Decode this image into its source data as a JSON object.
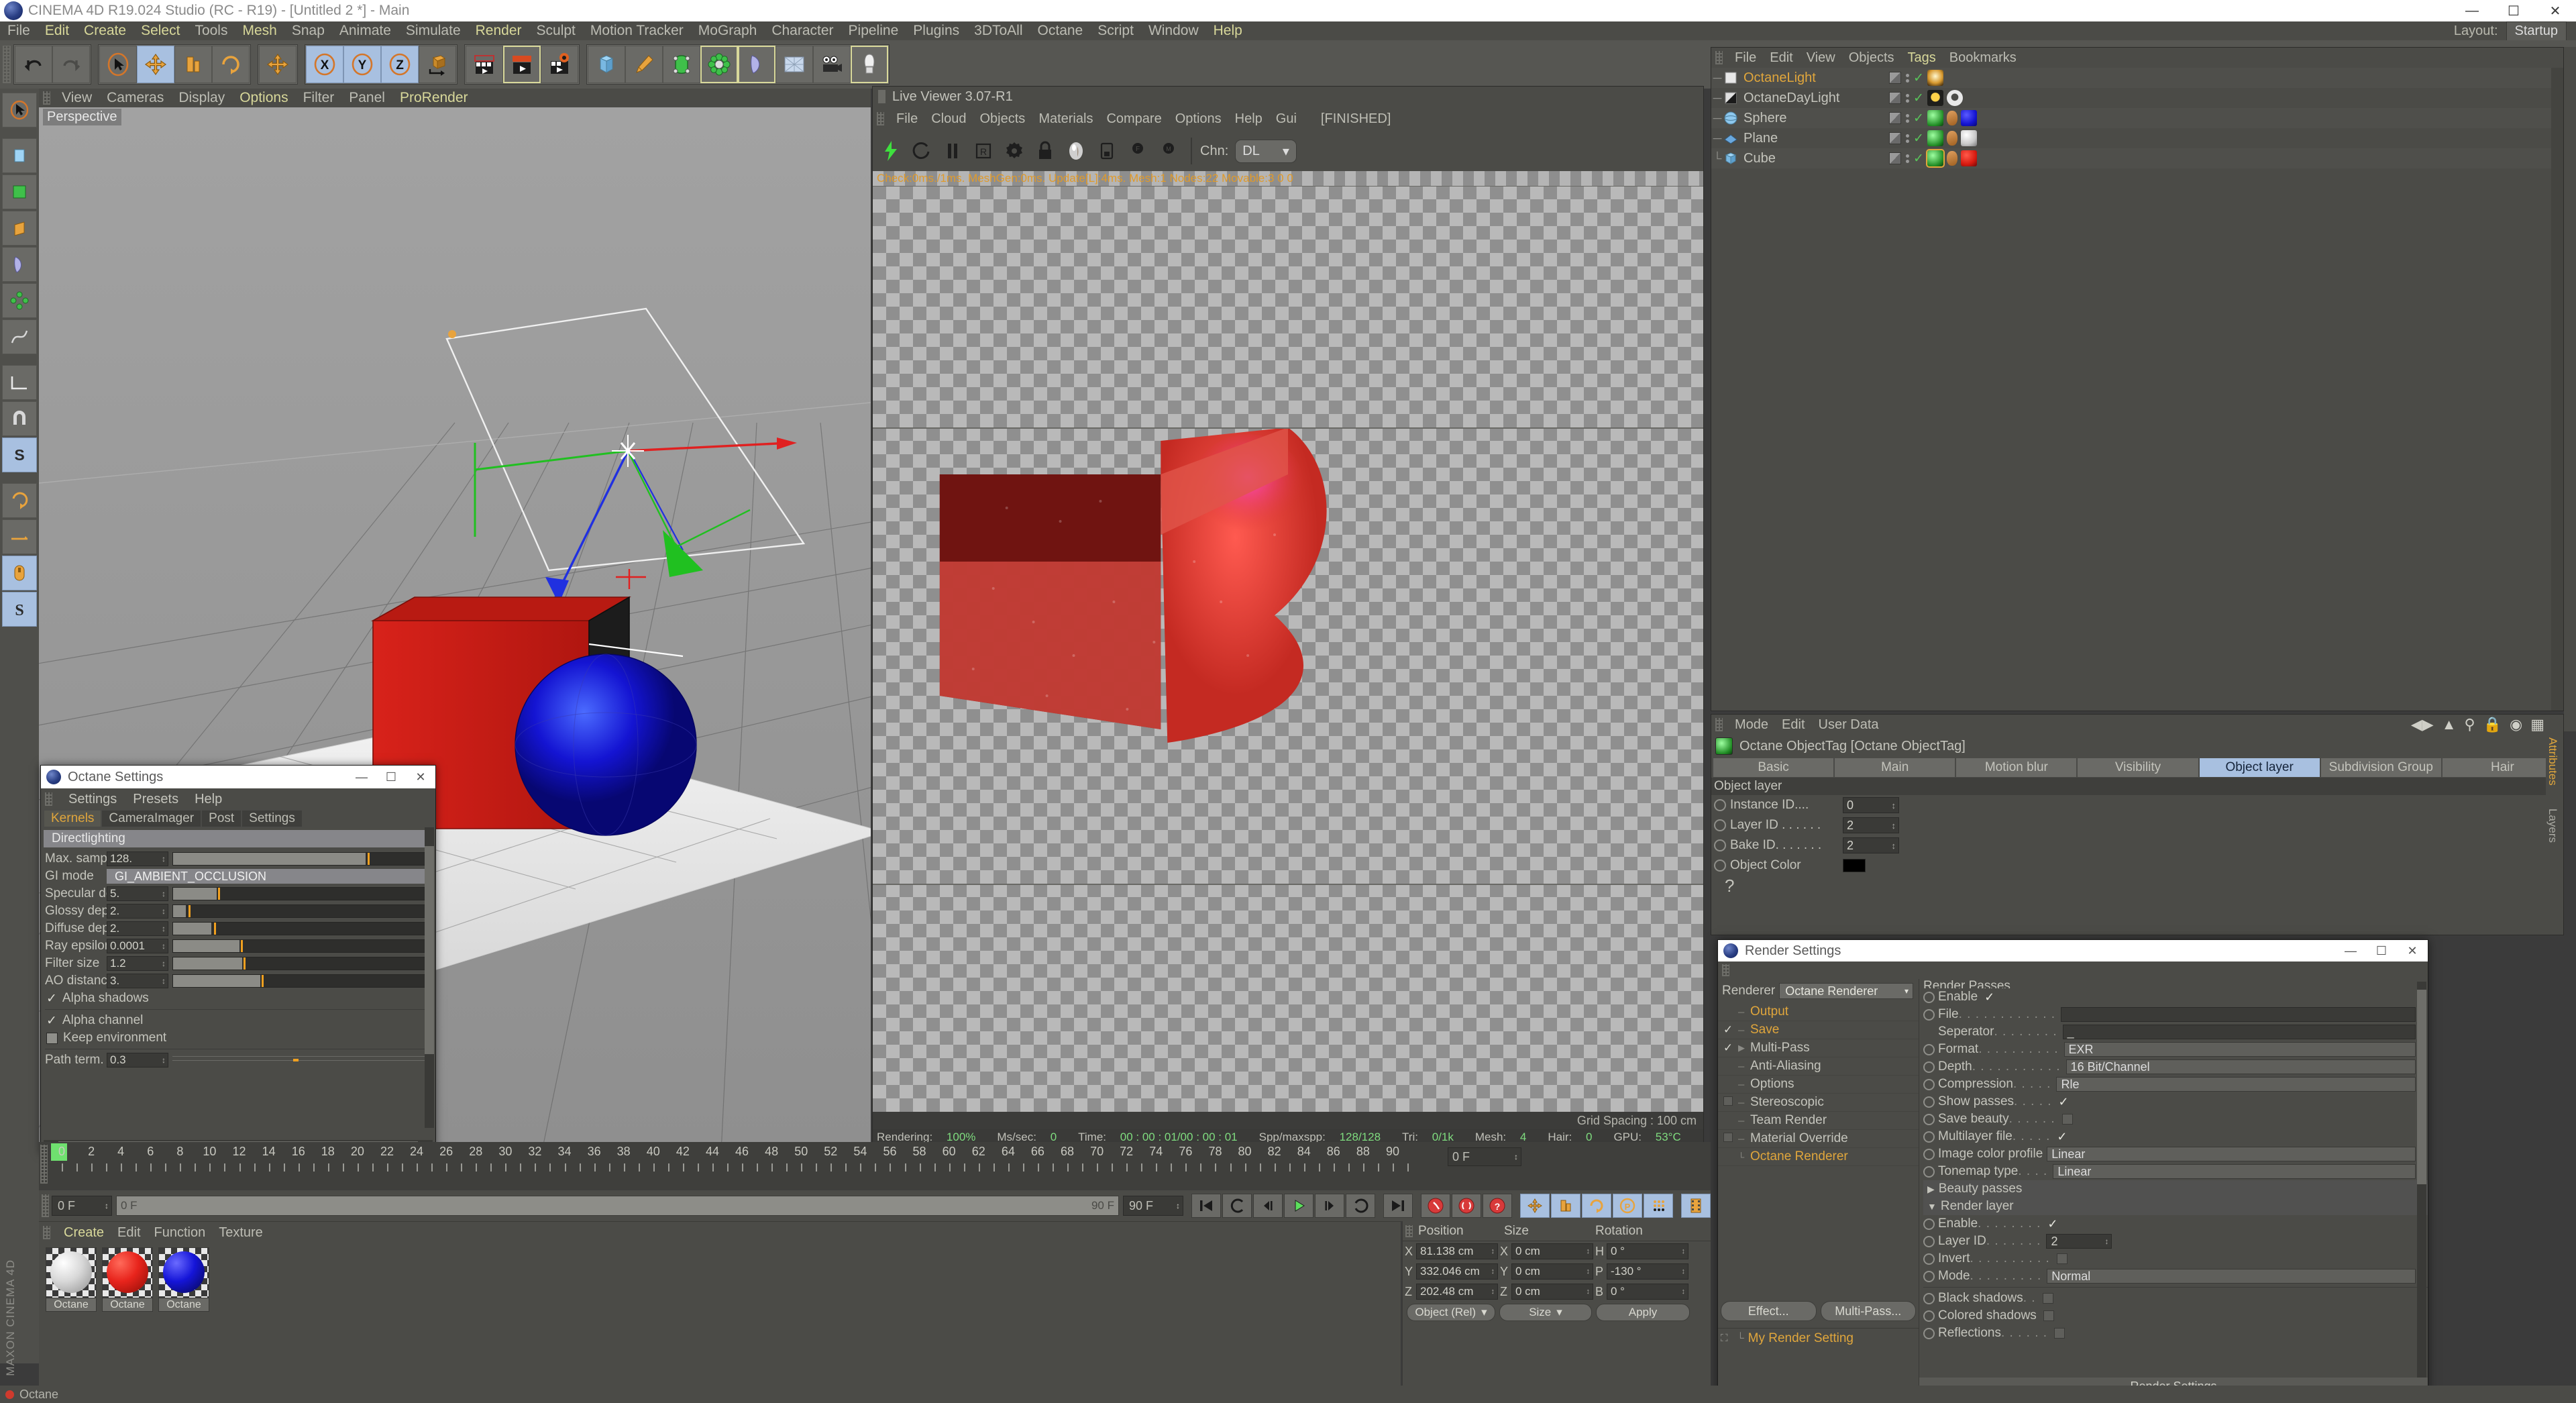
{
  "window": {
    "title": "CINEMA 4D R19.024 Studio (RC - R19) - [Untitled 2 *] - Main",
    "minimize": "—",
    "maximize": "☐",
    "close": "✕"
  },
  "menubar": {
    "items": [
      "File",
      "Edit",
      "Create",
      "Select",
      "Tools",
      "Mesh",
      "Snap",
      "Animate",
      "Simulate",
      "Render",
      "Sculpt",
      "Motion Tracker",
      "MoGraph",
      "Character",
      "Pipeline",
      "Plugins",
      "3DToAll",
      "Octane",
      "Script",
      "Window",
      "Help"
    ],
    "layout_label": "Layout:",
    "layout_value": "Startup"
  },
  "viewport": {
    "menu": [
      "View",
      "Cameras",
      "Display",
      "Options",
      "Filter",
      "Panel",
      "ProRender"
    ],
    "label": "Perspective",
    "grid_spacing": "Grid Spacing : 100 cm"
  },
  "live_viewer": {
    "title": "Live Viewer 3.07-R1",
    "menu": [
      "File",
      "Cloud",
      "Objects",
      "Materials",
      "Compare",
      "Options",
      "Help",
      "Gui"
    ],
    "state": "[FINISHED]",
    "channel_label": "Chn:",
    "channel_value": "DL",
    "info": "Check:0ms./1ms. MeshGen:0ms. Update[L]:4ms. Mesh:1 Nodes:22 Movable:3  0 0",
    "status": [
      {
        "label": "Rendering:",
        "value": "100%"
      },
      {
        "label": "Ms/sec:",
        "value": "0"
      },
      {
        "label": "Time:",
        "value": "00 : 00 : 01/00 : 00 : 01"
      },
      {
        "label": "Spp/maxspp:",
        "value": "128/128"
      },
      {
        "label": "Tri:",
        "value": "0/1k"
      },
      {
        "label": "Mesh:",
        "value": "4"
      },
      {
        "label": "Hair:",
        "value": "0"
      },
      {
        "label": "GPU:",
        "value": "53°C"
      }
    ]
  },
  "object_manager": {
    "menu": [
      "File",
      "Edit",
      "View",
      "Objects",
      "Tags",
      "Bookmarks"
    ],
    "objects": [
      {
        "name": "OctaneLight",
        "selected": true,
        "icon": "light-icon",
        "tags": [
          "light-tag"
        ]
      },
      {
        "name": "OctaneDayLight",
        "selected": false,
        "icon": "daylight-icon",
        "tags": [
          "sun-tag",
          "gear-tag"
        ]
      },
      {
        "name": "Sphere",
        "selected": false,
        "icon": "sphere-icon",
        "tags": [
          "octane-tag",
          "texture-tag",
          "material-blue"
        ]
      },
      {
        "name": "Plane",
        "selected": false,
        "icon": "plane-icon",
        "tags": [
          "octane-tag",
          "texture-tag",
          "material-white"
        ]
      },
      {
        "name": "Cube",
        "selected": false,
        "icon": "cube-icon",
        "tags": [
          "octane-tag-active",
          "texture-tag",
          "material-red"
        ]
      }
    ]
  },
  "attributes": {
    "menu": [
      "Mode",
      "Edit",
      "User Data"
    ],
    "object_title": "Octane ObjectTag [Octane ObjectTag]",
    "tabs": [
      "Basic",
      "Main",
      "Motion blur",
      "Visibility",
      "Object layer",
      "Subdivision Group",
      "Hair"
    ],
    "active_tab": "Object layer",
    "group_title": "Object layer",
    "fields": [
      {
        "label": "Instance ID....",
        "value": "0",
        "type": "number"
      },
      {
        "label": "Layer ID . . . . . .",
        "value": "2",
        "type": "number"
      },
      {
        "label": "Bake ID. . . . . . .",
        "value": "2",
        "type": "number"
      },
      {
        "label": "Object Color",
        "value": "#000000",
        "type": "color"
      }
    ],
    "side_tabs": [
      "Attributes",
      "Layers"
    ]
  },
  "octane_settings": {
    "title": "Octane Settings",
    "menu": [
      "Settings",
      "Presets",
      "Help"
    ],
    "tabs": [
      "Kernels",
      "CameraImager",
      "Post",
      "Settings"
    ],
    "active_tab": "Kernels",
    "kernel_header": "Directlighting",
    "params": [
      {
        "label": "Max. samples",
        "value": "128.",
        "slider": true,
        "fill": 75,
        "handle": 77
      },
      {
        "label": "GI mode",
        "value": "GI_AMBIENT_OCCLUSION",
        "slider": false
      },
      {
        "label": "Specular depth",
        "value": "5.",
        "slider": true,
        "fill": 17,
        "handle": 18
      },
      {
        "label": "Glossy depth",
        "value": "2.",
        "slider": true,
        "fill": 5,
        "handle": 6.5
      },
      {
        "label": "Diffuse depth",
        "value": "2.",
        "slider": true,
        "fill": 15,
        "handle": 16.5
      },
      {
        "label": "Ray epsilon",
        "value": "0.0001",
        "slider": true,
        "fill": 26,
        "handle": 27
      },
      {
        "label": "Filter size",
        "value": "1.2",
        "slider": true,
        "fill": 27,
        "handle": 28
      },
      {
        "label": "AO distance",
        "value": "3.",
        "slider": true,
        "fill": 34,
        "handle": 35
      }
    ],
    "checks": [
      {
        "label": "Alpha shadows",
        "checked": true
      },
      {
        "label": "Alpha channel",
        "checked": true
      },
      {
        "label": "Keep environment",
        "checked": false
      }
    ],
    "path_term": {
      "label": "Path term. power",
      "value": "0.3"
    }
  },
  "render_settings": {
    "title": "Render Settings",
    "renderer_label": "Renderer",
    "renderer_value": "Octane Renderer",
    "tree": [
      {
        "name": "Output",
        "check": "none",
        "highlight": true
      },
      {
        "name": "Save",
        "check": "checked",
        "highlight": true
      },
      {
        "name": "Multi-Pass",
        "check": "checked",
        "highlight": false,
        "arrow": true
      },
      {
        "name": "Anti-Aliasing",
        "check": "none",
        "highlight": false
      },
      {
        "name": "Options",
        "check": "none",
        "highlight": false
      },
      {
        "name": "Stereoscopic",
        "check": "box",
        "highlight": false
      },
      {
        "name": "Team Render",
        "check": "none",
        "highlight": false
      },
      {
        "name": "Material Override",
        "check": "box",
        "highlight": false
      },
      {
        "name": "Octane Renderer",
        "check": "none",
        "highlight": true
      }
    ],
    "buttons": [
      "Effect...",
      "Multi-Pass..."
    ],
    "my_render_setting": "My Render Setting",
    "panel_header": "Render Passes",
    "rows": [
      {
        "label": "Enable",
        "dots": "",
        "type": "check",
        "value": true
      },
      {
        "label": "File",
        "dots": ". . . . . . . . . . . .",
        "type": "text",
        "value": ""
      },
      {
        "label": "Seperator",
        "dots": ". . . . . . . .",
        "type": "text",
        "value": "_",
        "indent": true
      },
      {
        "label": "Format",
        "dots": ". . . . . . . . . .",
        "type": "select",
        "value": "EXR"
      },
      {
        "label": "Depth",
        "dots": ". . . . . . . . . . .",
        "type": "select",
        "value": "16 Bit/Channel"
      },
      {
        "label": "Compression",
        "dots": ". . . . .",
        "type": "select",
        "value": "Rle"
      },
      {
        "label": "Show passes",
        "dots": ". . . . .",
        "type": "check",
        "value": true
      },
      {
        "label": "Save beauty",
        "dots": ". . . . . .",
        "type": "check",
        "value": false
      },
      {
        "label": "Multilayer file",
        "dots": ". . . . .",
        "type": "check",
        "value": true
      },
      {
        "label": "Image color profile",
        "dots": "",
        "type": "select",
        "value": "Linear"
      },
      {
        "label": "Tonemap type",
        "dots": ". . . .",
        "type": "select",
        "value": "Linear"
      }
    ],
    "sections": [
      {
        "label": "Beauty passes",
        "expanded": false
      },
      {
        "label": "Render layer",
        "expanded": true
      }
    ],
    "layer_rows": [
      {
        "label": "Enable",
        "dots": ". . . . . . . .",
        "type": "check",
        "value": true
      },
      {
        "label": "Layer ID",
        "dots": ". . . . . . .",
        "type": "number",
        "value": "2"
      },
      {
        "label": "Invert",
        "dots": ". . . . . . . . . .",
        "type": "check",
        "value": false
      },
      {
        "label": "Mode",
        "dots": ". . . . . . . . .",
        "type": "select",
        "value": "Normal"
      }
    ],
    "shadow_rows": [
      {
        "label": "Black shadows",
        "dots": ". .",
        "type": "check",
        "value": false
      },
      {
        "label": "Colored shadows",
        "dots": "",
        "type": "check",
        "value": false
      },
      {
        "label": "Reflections",
        "dots": ". . . . . .",
        "type": "check",
        "value": false
      }
    ],
    "footer": "Render Settings"
  },
  "timeline": {
    "ticks": [
      0,
      2,
      4,
      6,
      8,
      10,
      12,
      14,
      16,
      18,
      20,
      22,
      24,
      26,
      28,
      30,
      32,
      34,
      36,
      38,
      40,
      42,
      44,
      46,
      48,
      50,
      52,
      54,
      56,
      58,
      60,
      62,
      64,
      66,
      68,
      70,
      72,
      74,
      76,
      78,
      80,
      82,
      84,
      86,
      88,
      90
    ],
    "current_frame": "0 F",
    "end_frame": "90 F",
    "preview_start": "0 F",
    "preview_end": "90 F"
  },
  "material_manager": {
    "menu": [
      "Create",
      "Edit",
      "Function",
      "Texture"
    ],
    "materials": [
      {
        "name": "Octane",
        "color": "#dedede"
      },
      {
        "name": "Octane",
        "color": "#e8241c"
      },
      {
        "name": "Octane",
        "color": "#1515d8"
      }
    ]
  },
  "coordinates": {
    "headers": [
      "Position",
      "Size",
      "Rotation"
    ],
    "rows": [
      {
        "axis": "X",
        "position": "81.138 cm",
        "size2": "X",
        "size": "0 cm",
        "rot_axis": "H",
        "rotation": "0 °"
      },
      {
        "axis": "Y",
        "position": "332.046 cm",
        "size2": "Y",
        "size": "0 cm",
        "rot_axis": "P",
        "rotation": "-130 °"
      },
      {
        "axis": "Z",
        "position": "202.48 cm",
        "size2": "Z",
        "size": "0 cm",
        "rot_axis": "B",
        "rotation": "0 °"
      }
    ],
    "mode": "Object (Rel)",
    "size_mode": "Size",
    "apply": "Apply"
  },
  "status_bar": {
    "text": "Octane"
  },
  "brand": "MAXON CINEMA 4D"
}
